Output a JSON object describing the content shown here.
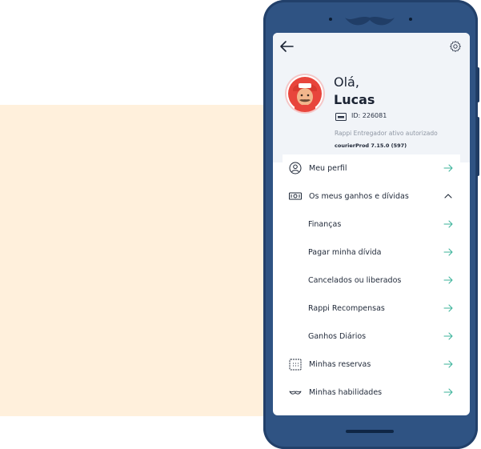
{
  "profile": {
    "greeting": "Olá,",
    "name": "Lucas",
    "id_label": "ID: 226081",
    "status": "Rappi Entregador ativo autorizado",
    "version": "courierProd 7.15.0 (597)"
  },
  "menu": {
    "items": [
      {
        "label": "Meu perfil",
        "icon": "user-circle-icon",
        "action": "arrow"
      },
      {
        "label": "Os meus ganhos e dívidas",
        "icon": "banknote-icon",
        "action": "chevron-up"
      },
      {
        "label": "Finanças",
        "sub": true
      },
      {
        "label": "Pagar minha dívida",
        "sub": true
      },
      {
        "label": "Cancelados ou liberados",
        "sub": true
      },
      {
        "label": "Rappi Recompensas",
        "sub": true
      },
      {
        "label": "Ganhos Diários",
        "sub": true
      },
      {
        "label": "Minhas reservas",
        "icon": "calendar-icon",
        "action": "arrow"
      },
      {
        "label": "Minhas habilidades",
        "icon": "mustache-icon",
        "action": "arrow"
      }
    ]
  },
  "colors": {
    "phone": "#2f5383",
    "accent_arrow": "#3bb39a",
    "peach": "#fff0dc",
    "header_bg": "#f1f4f8"
  }
}
